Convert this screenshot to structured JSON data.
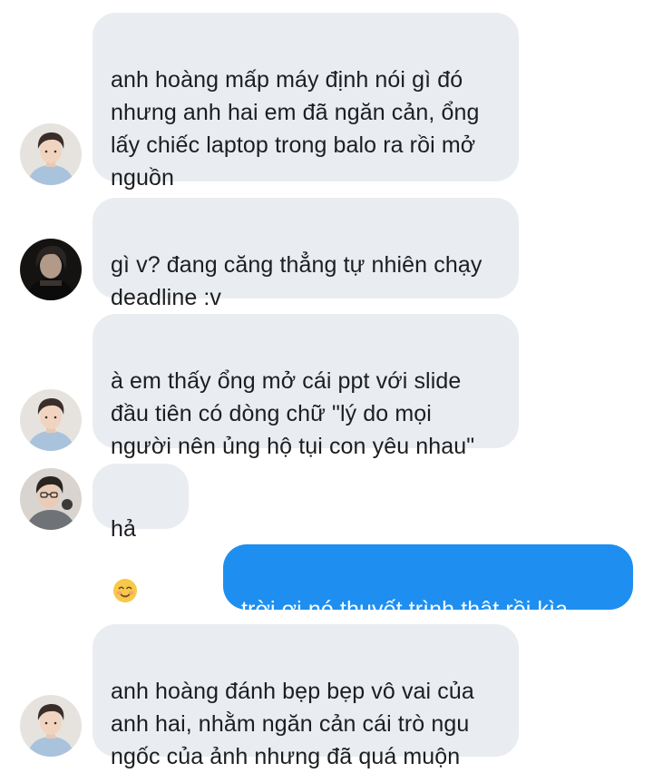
{
  "messages": [
    {
      "sender": "incoming",
      "avatar": "avatar-boy-blue-hoodie",
      "text": "anh hoàng mấp máy định nói gì đó\nnhưng anh hai em đã ngăn cản, ổng\nlấy chiếc laptop trong balo ra rồi mở\nnguồn",
      "emoji": null
    },
    {
      "sender": "incoming",
      "avatar": "avatar-dark-photo",
      "text": "gì v? đang căng thẳng tự nhiên chạy\ndeadline :v",
      "emoji": null
    },
    {
      "sender": "incoming",
      "avatar": "avatar-boy-blue-hoodie",
      "text": "à em thấy ổng mở cái ppt với slide\nđầu tiên có dòng chữ \"lý do mọi\nngười nên ủng hộ tụi con yêu nhau\"",
      "emoji": null
    },
    {
      "sender": "incoming",
      "avatar": "avatar-boy-glasses",
      "text": "hả",
      "emoji": "smiling-face-emoji"
    },
    {
      "sender": "outgoing",
      "avatar": null,
      "text": "trời ơi nó thuyết trình thật rồi kìa",
      "emoji": "smiling-face-emoji"
    },
    {
      "sender": "incoming",
      "avatar": "avatar-boy-blue-hoodie",
      "text": "anh hoàng đánh bẹp bẹp vô vai của\nanh hai, nhằm ngăn cản cái trò ngu\nngốc của ảnh nhưng đã quá muộn",
      "emoji": null
    }
  ],
  "colors": {
    "incoming_bubble": "#e9ecf0",
    "outgoing_bubble": "#1e8ff0",
    "incoming_text": "#1c1e21",
    "outgoing_text": "#ffffff"
  }
}
